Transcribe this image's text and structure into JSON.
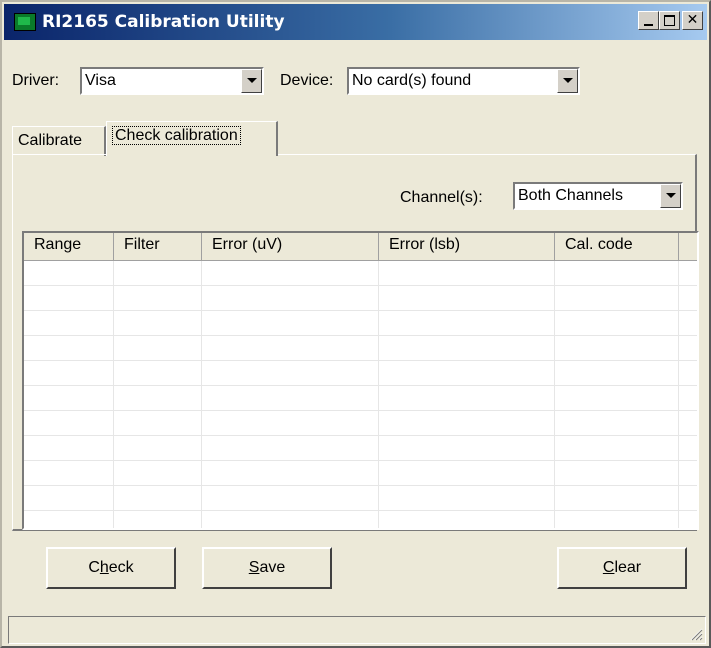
{
  "window": {
    "title": "RI2165 Calibration Utility",
    "controls": {
      "minimize": "_",
      "maximize": "□",
      "close": "✕"
    }
  },
  "toolbar": {
    "driver_label": "Driver:",
    "driver_value": "Visa",
    "device_label": "Device:",
    "device_value": "No card(s) found"
  },
  "tabs": [
    {
      "label": "Calibrate",
      "active": false
    },
    {
      "label": "Check calibration",
      "active": true
    }
  ],
  "channel": {
    "label": "Channel(s):",
    "value": "Both Channels"
  },
  "table": {
    "columns": [
      "Range",
      "Filter",
      "Error (uV)",
      "Error (lsb)",
      "Cal. code"
    ],
    "rows": []
  },
  "buttons": {
    "check": {
      "pre": "C",
      "ul": "h",
      "post": "eck"
    },
    "save": {
      "pre": "",
      "ul": "S",
      "post": "ave"
    },
    "clear": {
      "pre": "",
      "ul": "C",
      "post": "lear"
    }
  },
  "statusbar": {
    "text": ""
  },
  "colors": {
    "title_gradient_start": "#0a246a",
    "title_gradient_end": "#a6caf0",
    "face": "#ece9d8"
  },
  "icons": [
    "app-icon",
    "minimize-icon",
    "maximize-icon",
    "close-icon",
    "dropdown-arrow-icon",
    "resize-grip-icon"
  ]
}
